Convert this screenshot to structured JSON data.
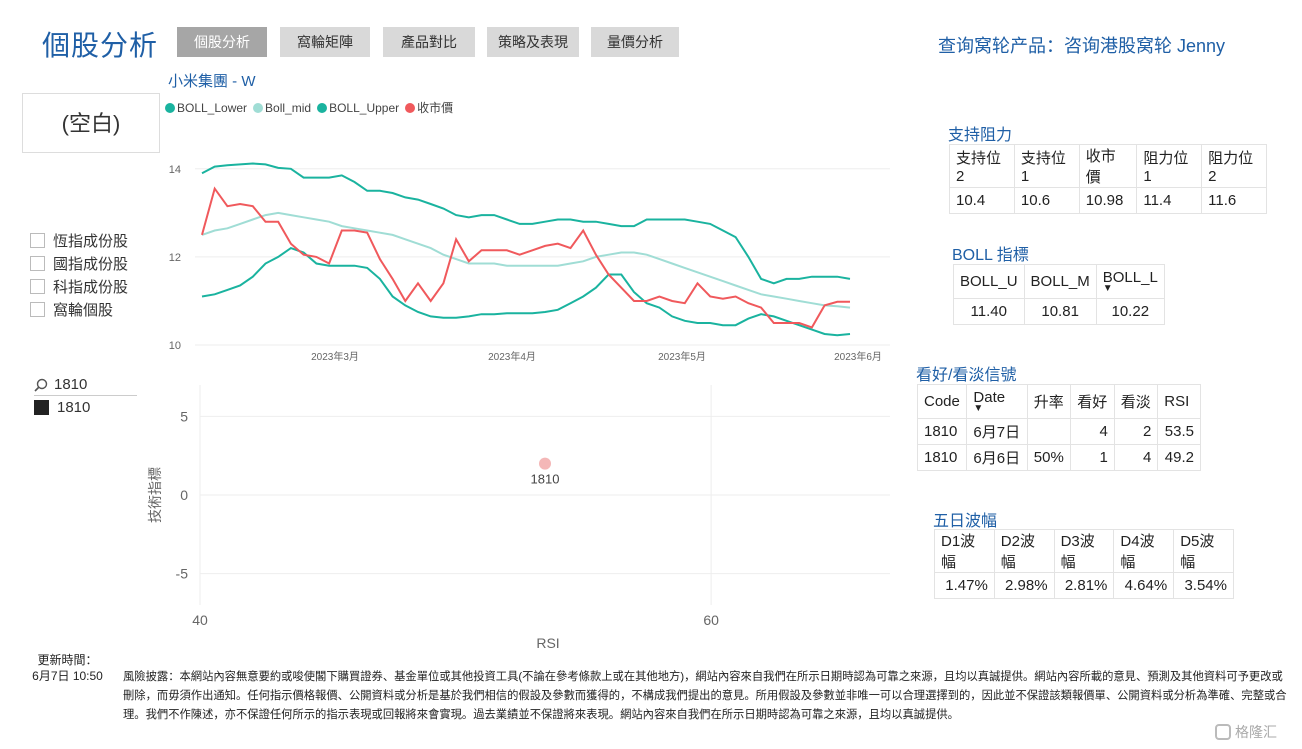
{
  "header": {
    "title": "個股分析",
    "tabs": [
      {
        "label": "個股分析",
        "active": true
      },
      {
        "label": "窩輪矩陣",
        "active": false
      },
      {
        "label": "產品對比",
        "active": false
      },
      {
        "label": "策略及表現",
        "active": false
      },
      {
        "label": "量價分析",
        "active": false
      }
    ],
    "query_link": "查询窝轮产品：咨询港股窝轮 Jenny"
  },
  "sidebar": {
    "blank_label": "(空白)",
    "checkboxes": [
      "恆指成份股",
      "國指成份股",
      "科指成份股",
      "窩輪個股"
    ],
    "search_value": "1810",
    "search_result": "1810"
  },
  "colors": {
    "boll_lower": "#1ab39f",
    "boll_mid": "#a0ddd5",
    "boll_upper": "#1ab39f",
    "close": "#f0595c",
    "scatter_point": "#f4b7b7"
  },
  "line_chart": {
    "title": "小米集團 - W",
    "legend": [
      "BOLL_Lower",
      "Boll_mid",
      "BOLL_Upper",
      "收市價"
    ],
    "y_ticks": [
      "14",
      "12",
      "10"
    ],
    "x_ticks": [
      "2023年3月",
      "2023年4月",
      "2023年5月",
      "2023年6月"
    ]
  },
  "chart_data": [
    {
      "type": "line",
      "title": "小米集團 - W",
      "ylim": [
        10,
        14.2
      ],
      "x_ticks": [
        "2023年3月",
        "2023年4月",
        "2023年5月",
        "2023年6月"
      ],
      "series": [
        {
          "name": "BOLL_Upper",
          "values": [
            13.9,
            14.05,
            14.08,
            14.1,
            14.12,
            14.1,
            14.02,
            14.0,
            13.8,
            13.8,
            13.8,
            13.85,
            13.7,
            13.5,
            13.5,
            13.45,
            13.35,
            13.3,
            13.2,
            13.1,
            12.95,
            12.9,
            12.95,
            12.95,
            12.85,
            12.75,
            12.75,
            12.8,
            12.85,
            12.85,
            12.8,
            12.8,
            12.75,
            12.7,
            12.7,
            12.85,
            12.85,
            12.85,
            12.85,
            12.8,
            12.75,
            12.6,
            12.45,
            12.0,
            11.5,
            11.4,
            11.5,
            11.5,
            11.55,
            11.55,
            11.55,
            11.5
          ]
        },
        {
          "name": "Boll_mid",
          "values": [
            12.5,
            12.6,
            12.65,
            12.75,
            12.85,
            12.95,
            13.0,
            12.95,
            12.9,
            12.85,
            12.8,
            12.7,
            12.65,
            12.6,
            12.55,
            12.5,
            12.4,
            12.3,
            12.2,
            12.05,
            11.95,
            11.85,
            11.85,
            11.85,
            11.8,
            11.8,
            11.8,
            11.8,
            11.8,
            11.85,
            11.9,
            12.0,
            12.05,
            12.1,
            12.1,
            12.05,
            11.95,
            11.85,
            11.75,
            11.65,
            11.55,
            11.45,
            11.35,
            11.25,
            11.15,
            11.1,
            11.05,
            11.0,
            10.95,
            10.9,
            10.88,
            10.85
          ]
        },
        {
          "name": "BOLL_Lower",
          "values": [
            11.1,
            11.15,
            11.25,
            11.35,
            11.55,
            11.85,
            12.0,
            12.2,
            12.1,
            11.85,
            11.8,
            11.8,
            11.8,
            11.75,
            11.5,
            11.1,
            10.9,
            10.75,
            10.65,
            10.62,
            10.62,
            10.65,
            10.7,
            10.7,
            10.72,
            10.72,
            10.72,
            10.75,
            10.8,
            10.95,
            11.1,
            11.3,
            11.6,
            11.6,
            11.2,
            10.95,
            10.85,
            10.65,
            10.55,
            10.5,
            10.5,
            10.45,
            10.45,
            10.6,
            10.7,
            10.65,
            10.55,
            10.45,
            10.35,
            10.25,
            10.22,
            10.25
          ]
        },
        {
          "name": "收市價",
          "values": [
            12.5,
            13.55,
            13.15,
            13.2,
            13.15,
            12.8,
            12.8,
            12.3,
            12.05,
            12.0,
            11.85,
            12.6,
            12.6,
            12.55,
            11.95,
            11.5,
            11.0,
            11.4,
            11.0,
            11.4,
            12.4,
            11.9,
            12.15,
            12.15,
            12.15,
            12.05,
            12.15,
            12.25,
            12.3,
            12.2,
            12.6,
            12.05,
            11.6,
            11.3,
            11.0,
            11.0,
            11.1,
            11.0,
            10.95,
            11.4,
            11.1,
            11.05,
            11.1,
            10.95,
            10.85,
            10.5,
            10.5,
            10.5,
            10.4,
            10.9,
            10.98,
            10.98
          ]
        }
      ]
    },
    {
      "type": "scatter",
      "xlabel": "RSI",
      "ylabel": "技術指標",
      "xlim": [
        40,
        67
      ],
      "ylim": [
        -7,
        7
      ],
      "x_ticks": [
        "40",
        "60"
      ],
      "y_ticks": [
        "5",
        "0",
        "-5"
      ],
      "points": [
        {
          "label": "1810",
          "x": 53.5,
          "y": 2
        }
      ]
    }
  ],
  "scatter_chart": {
    "xlabel": "RSI",
    "ylabel": "技術指標",
    "x_ticks": [
      "40",
      "60"
    ],
    "y_ticks": [
      "5",
      "0",
      "-5"
    ],
    "point_label": "1810"
  },
  "support_resistance": {
    "title": "支持阻力",
    "headers": [
      "支持位2",
      "支持位1",
      "收市價",
      "阻力位1",
      "阻力位2"
    ],
    "values": [
      "10.4",
      "10.6",
      "10.98",
      "11.4",
      "11.6"
    ]
  },
  "boll": {
    "title": "BOLL 指標",
    "headers": [
      "BOLL_U",
      "BOLL_M",
      "BOLL_L"
    ],
    "values": [
      "11.40",
      "10.81",
      "10.22"
    ]
  },
  "signals": {
    "title": "看好/看淡信號",
    "headers": [
      "Code",
      "Date",
      "升率",
      "看好",
      "看淡",
      "RSI"
    ],
    "rows": [
      [
        "1810",
        "6月7日",
        "",
        "4",
        "2",
        "53.5"
      ],
      [
        "1810",
        "6月6日",
        "50%",
        "1",
        "4",
        "49.2"
      ]
    ]
  },
  "volatility": {
    "title": "五日波幅",
    "headers": [
      "D1波幅",
      "D2波幅",
      "D3波幅",
      "D4波幅",
      "D5波幅"
    ],
    "values": [
      "1.47%",
      "2.98%",
      "2.81%",
      "4.64%",
      "3.54%"
    ]
  },
  "footer": {
    "update_label": "更新時間：",
    "update_time": "6月7日 10:50",
    "disclaimer": "風險披露：本網站內容無意要約或唆使閣下購買證券、基金單位或其他投資工具(不論在參考條款上或在其他地方)，網站內容來自我們在所示日期時認為可靠之來源，且均以真誠提供。網站內容所載的意見、預測及其他資料可予更改或刪除，而毋須作出通知。任何指示價格報價、公開資料或分析是基於我們相信的假設及參數而獲得的，不構成我們提出的意見。所用假設及參數並非唯一可以合理選擇到的，因此並不保證該類報價單、公開資料或分析為準確、完整或合理。我們不作陳述，亦不保證任何所示的指示表現或回報將來會實現。過去業績並不保證將來表現。網站內容來自我們在所示日期時認為可靠之來源，且均以真誠提供。",
    "watermark": "格隆汇"
  }
}
